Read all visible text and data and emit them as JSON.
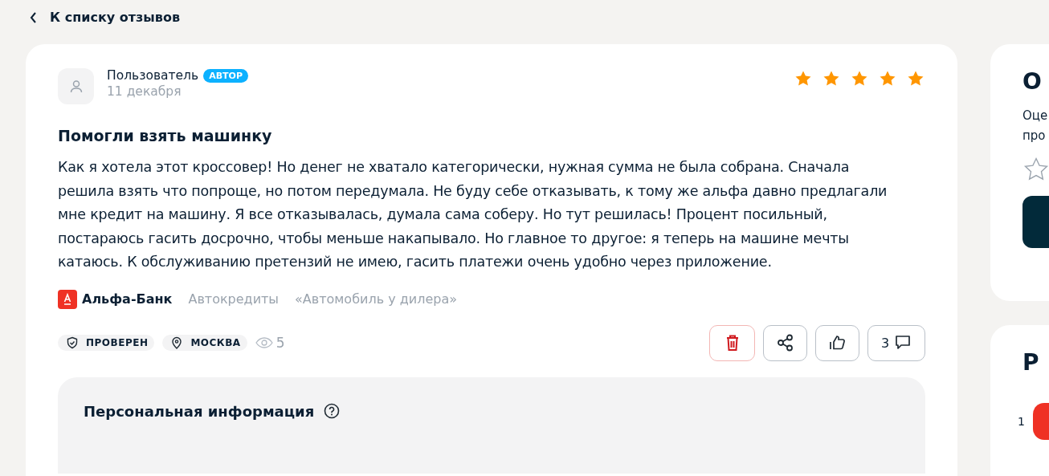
{
  "back_link": {
    "label": "К списку отзывов"
  },
  "review": {
    "author": "Пользователь",
    "author_badge": "АВТОР",
    "date": "11 декабря",
    "stars": 5,
    "title": "Помогли взять машинку",
    "text": "Как я хотела этот кроссовер! Но денег не хватало категорически, нужная сумма не была собрана. Сначала решила взять что попроще, но потом передумала. Не буду себе отказывать, к тому же альфа давно предлагали мне кредит на машину. Я все отказывалась, думала сама соберу. Но тут решилась! Процент посильный, постараюсь гасить досрочно, чтобы меньше накапывало. Но главное то другое: я теперь на машине мечты катаюсь. К обслуживанию претензий не имею, гасить платежи очень удобно через приложение.",
    "bank": "Альфа-Банк",
    "category": "Автокредиты",
    "product": "«Автомобиль у дилера»",
    "tags": [
      {
        "kind": "verified",
        "label": "ПРОВЕРЕН"
      },
      {
        "kind": "location",
        "label": "МОСКВА"
      }
    ],
    "views": "5",
    "actions": [
      {
        "kind": "delete"
      },
      {
        "kind": "share"
      },
      {
        "kind": "like"
      },
      {
        "kind": "comments",
        "label": "3"
      }
    ],
    "personal_info": {
      "title": "Персональная информация"
    }
  },
  "side_cards": [
    {
      "title": "О",
      "text_lines": [
        "Оце",
        "про"
      ]
    },
    {
      "title": "Р",
      "rank": "1"
    }
  ]
}
